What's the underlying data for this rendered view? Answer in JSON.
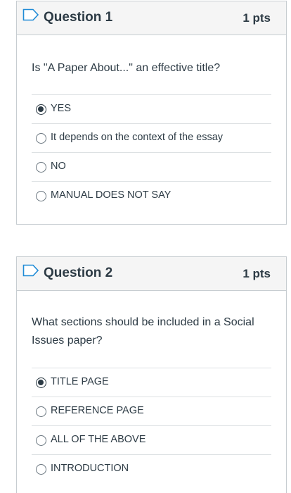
{
  "questions": [
    {
      "title": "Question 1",
      "points": "1 pts",
      "text": "Is \"A Paper About...\" an effective title?",
      "answers": [
        {
          "label": "YES",
          "selected": true
        },
        {
          "label": "It depends on the context of the essay",
          "selected": false
        },
        {
          "label": "NO",
          "selected": false
        },
        {
          "label": "MANUAL DOES NOT SAY",
          "selected": false
        }
      ]
    },
    {
      "title": "Question 2",
      "points": "1 pts",
      "text": "What sections should be included in a Social Issues paper?",
      "answers": [
        {
          "label": "TITLE PAGE",
          "selected": true
        },
        {
          "label": "REFERENCE PAGE",
          "selected": false
        },
        {
          "label": "ALL OF THE ABOVE",
          "selected": false
        },
        {
          "label": "INTRODUCTION",
          "selected": false
        }
      ]
    }
  ],
  "icons": {
    "flag": "bookmark-flag-icon"
  },
  "colors": {
    "flag_outline": "#1f8bd6",
    "text": "#2d3b45",
    "header_bg": "#f5f5f5",
    "border": "#c7cdd1"
  }
}
